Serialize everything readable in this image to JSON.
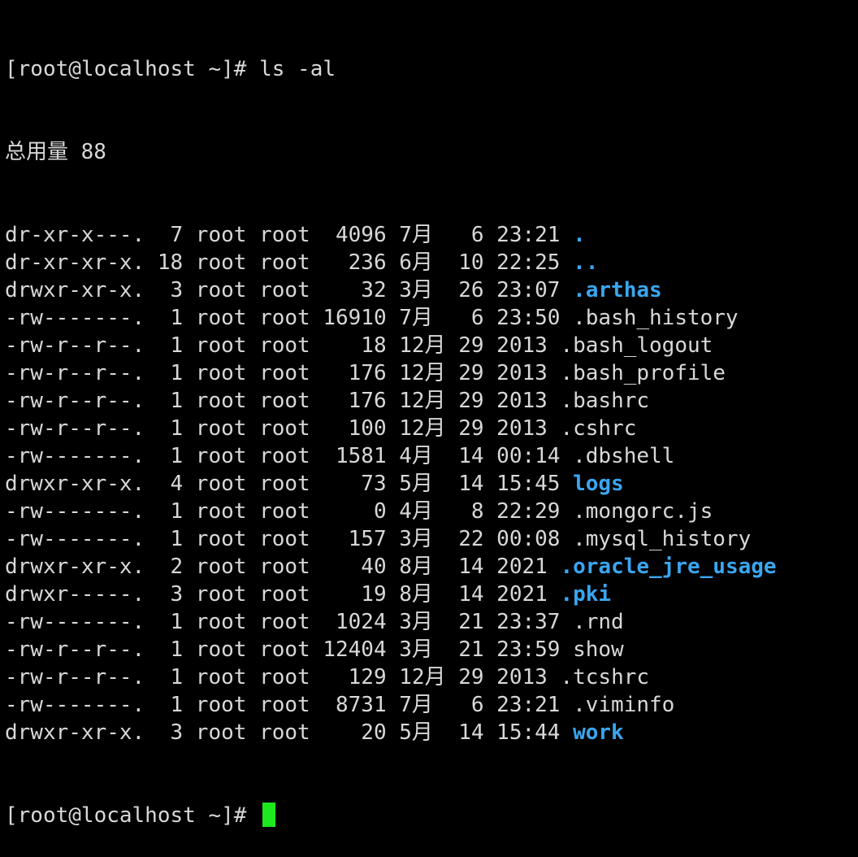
{
  "prompt": "[root@localhost ~]# ",
  "command": "ls -al",
  "total_line": "总用量 88",
  "listing": [
    {
      "meta": "dr-xr-x---.  7 root root  4096 7月   6 23:21 ",
      "name": ".",
      "is_dir": true
    },
    {
      "meta": "dr-xr-xr-x. 18 root root   236 6月  10 22:25 ",
      "name": "..",
      "is_dir": true
    },
    {
      "meta": "drwxr-xr-x.  3 root root    32 3月  26 23:07 ",
      "name": ".arthas",
      "is_dir": true
    },
    {
      "meta": "-rw-------.  1 root root 16910 7月   6 23:50 ",
      "name": ".bash_history",
      "is_dir": false
    },
    {
      "meta": "-rw-r--r--.  1 root root    18 12月 29 2013 ",
      "name": ".bash_logout",
      "is_dir": false
    },
    {
      "meta": "-rw-r--r--.  1 root root   176 12月 29 2013 ",
      "name": ".bash_profile",
      "is_dir": false
    },
    {
      "meta": "-rw-r--r--.  1 root root   176 12月 29 2013 ",
      "name": ".bashrc",
      "is_dir": false
    },
    {
      "meta": "-rw-r--r--.  1 root root   100 12月 29 2013 ",
      "name": ".cshrc",
      "is_dir": false
    },
    {
      "meta": "-rw-------.  1 root root  1581 4月  14 00:14 ",
      "name": ".dbshell",
      "is_dir": false
    },
    {
      "meta": "drwxr-xr-x.  4 root root    73 5月  14 15:45 ",
      "name": "logs",
      "is_dir": true
    },
    {
      "meta": "-rw-------.  1 root root     0 4月   8 22:29 ",
      "name": ".mongorc.js",
      "is_dir": false
    },
    {
      "meta": "-rw-------.  1 root root   157 3月  22 00:08 ",
      "name": ".mysql_history",
      "is_dir": false
    },
    {
      "meta": "drwxr-xr-x.  2 root root    40 8月  14 2021 ",
      "name": ".oracle_jre_usage",
      "is_dir": true
    },
    {
      "meta": "drwxr-----.  3 root root    19 8月  14 2021 ",
      "name": ".pki",
      "is_dir": true
    },
    {
      "meta": "-rw-------.  1 root root  1024 3月  21 23:37 ",
      "name": ".rnd",
      "is_dir": false
    },
    {
      "meta": "-rw-r--r--.  1 root root 12404 3月  21 23:59 ",
      "name": "show",
      "is_dir": false
    },
    {
      "meta": "-rw-r--r--.  1 root root   129 12月 29 2013 ",
      "name": ".tcshrc",
      "is_dir": false
    },
    {
      "meta": "-rw-------.  1 root root  8731 7月   6 23:21 ",
      "name": ".viminfo",
      "is_dir": false
    },
    {
      "meta": "drwxr-xr-x.  3 root root    20 5月  14 15:44 ",
      "name": "work",
      "is_dir": true
    }
  ],
  "colors": {
    "background": "#000000",
    "text": "#d8d8d8",
    "directory": "#3aa6f0",
    "cursor": "#1ee81e"
  }
}
